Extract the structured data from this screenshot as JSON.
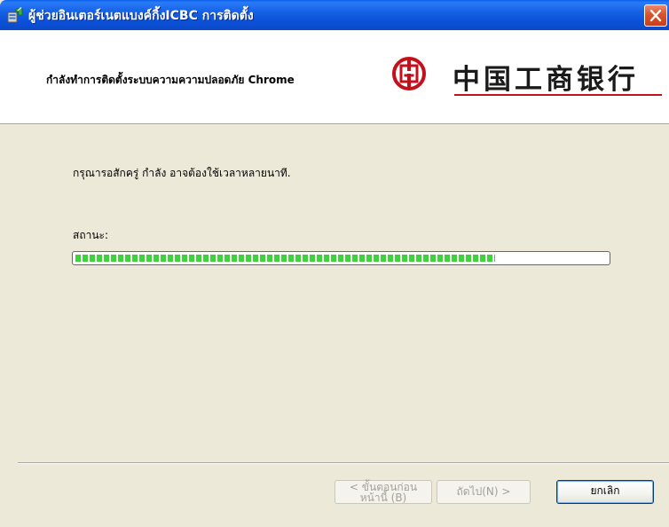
{
  "window": {
    "title": "ผู้ช่วยอินเตอร์เนตแบงค์กิ้งICBC การติดตั้ง"
  },
  "header": {
    "text": "กำลังทำการติดตั้งระบบความความปลอดภัย Chrome",
    "brand": "中国工商银行"
  },
  "body": {
    "message": "กรุณารอสักครู่ กำลัง  อาจต้องใช้เวลาหลายนาที.",
    "status_label": "สถานะ:",
    "progress": 0.79
  },
  "buttons": {
    "back_line1": "< ขั้นตอนก่อน",
    "back_line2": "หน้านี้ (B)",
    "next": "ถัดไป(N) >",
    "cancel": "ยกเลิก"
  },
  "colors": {
    "titlebar": "#0b52d8",
    "progress_fill": "#3dd33b",
    "brand_red": "#c40f1c"
  },
  "icons": {
    "title": "installer-icon",
    "close": "close-icon",
    "logo": "icbc-logo-icon"
  }
}
